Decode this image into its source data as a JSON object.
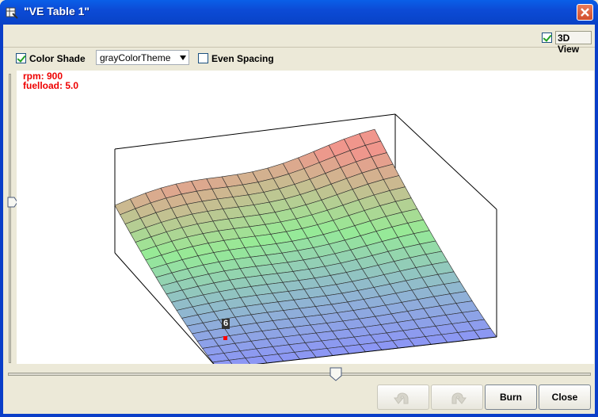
{
  "window": {
    "title": "\"VE Table 1\""
  },
  "top_bar": {
    "view_3d_label": "3D View",
    "view_3d_checked": true
  },
  "options": {
    "color_shade_label": "Color Shade",
    "color_shade_checked": true,
    "theme_value": "grayColorTheme",
    "even_spacing_label": "Even Spacing",
    "even_spacing_checked": false
  },
  "readout": {
    "rpm": "rpm: 900",
    "fuelload": "fuelload: 5.0"
  },
  "plot": {
    "cursor_value": "6",
    "cursor_color": "#FF0000"
  },
  "sliders": {
    "vertical_position": 0.42,
    "horizontal_position": 0.56
  },
  "buttons": {
    "undo_label": "",
    "redo_label": "",
    "burn_label": "Burn",
    "close_label": "Close"
  },
  "icons": {
    "window_icon": "table-icon",
    "close_icon": "close-x-icon",
    "undo_icon": "undo-arrow-icon",
    "redo_icon": "redo-arrow-icon"
  }
}
